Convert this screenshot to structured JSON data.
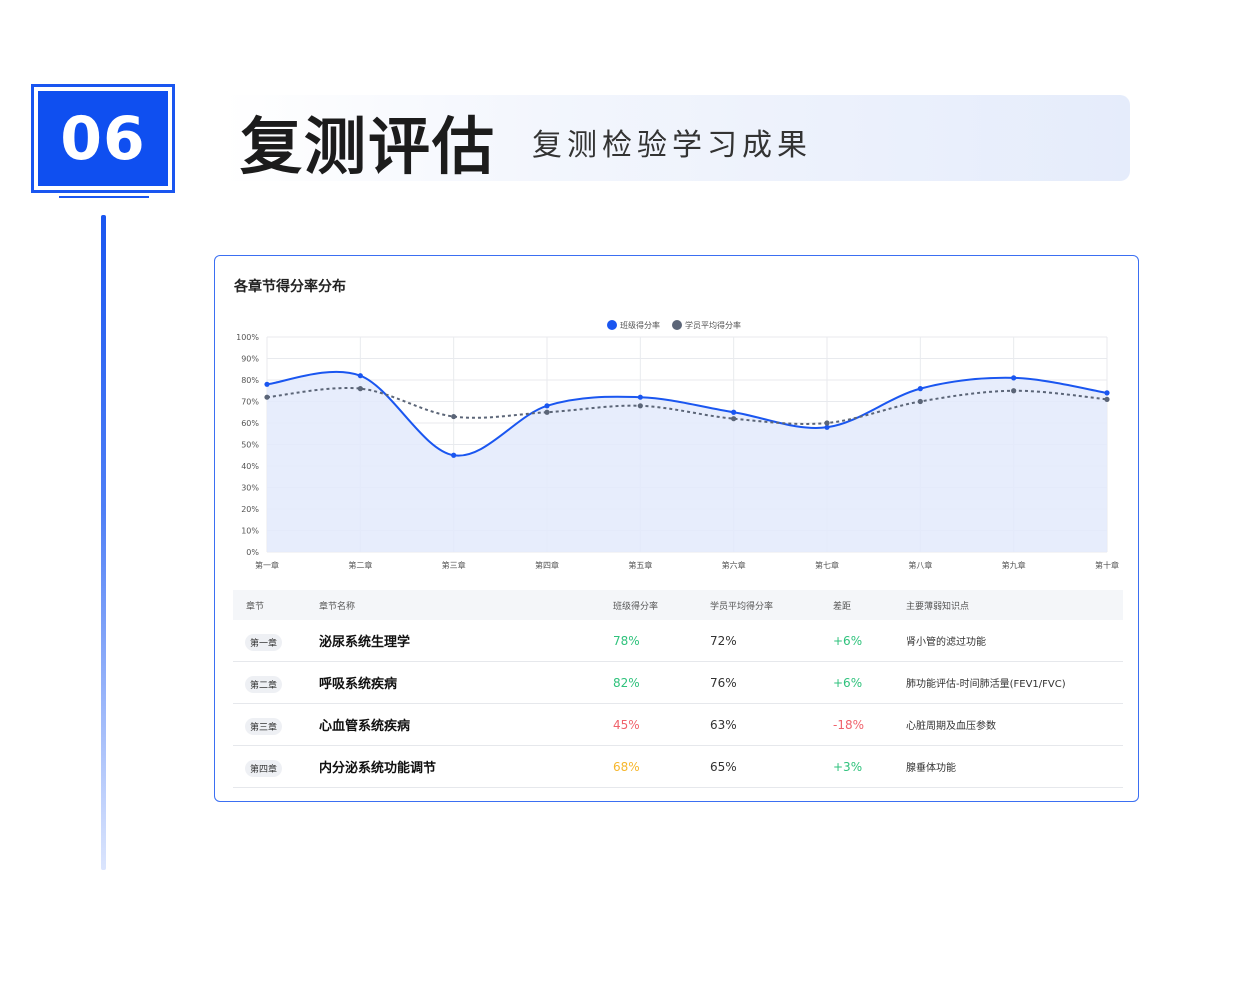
{
  "section": {
    "number": "06",
    "title": "复测评估",
    "subtitle": "复测检验学习成果"
  },
  "card": {
    "title": "各章节得分率分布"
  },
  "chart_data": {
    "type": "line",
    "categories": [
      "第一章",
      "第二章",
      "第三章",
      "第四章",
      "第五章",
      "第六章",
      "第七章",
      "第八章",
      "第九章",
      "第十章"
    ],
    "series": [
      {
        "name": "班级得分率",
        "values": [
          78,
          82,
          45,
          68,
          72,
          65,
          58,
          76,
          81,
          74
        ],
        "color": "#1a56f0",
        "style": "solid",
        "area": true
      },
      {
        "name": "学员平均得分率",
        "values": [
          72,
          76,
          63,
          65,
          68,
          62,
          60,
          70,
          75,
          71
        ],
        "color": "#5b6577",
        "style": "dashed",
        "area": false
      }
    ],
    "yticks": [
      "100%",
      "90%",
      "80%",
      "70%",
      "60%",
      "50%",
      "40%",
      "30%",
      "20%",
      "10%",
      "0%"
    ],
    "ylim": [
      0,
      100
    ],
    "grid": true,
    "legend_position": "top-center"
  },
  "table": {
    "headers": [
      "章节",
      "章节名称",
      "班级得分率",
      "学员平均得分率",
      "差距",
      "主要薄弱知识点"
    ],
    "rows": [
      {
        "chapter": "第一章",
        "name": "泌尿系统生理学",
        "class_rate": "78%",
        "avg_rate": "72%",
        "diff": "+6%",
        "weak": "肾小管的滤过功能",
        "rate_color": "green",
        "diff_color": "green"
      },
      {
        "chapter": "第二章",
        "name": "呼吸系统疾病",
        "class_rate": "82%",
        "avg_rate": "76%",
        "diff": "+6%",
        "weak": "肺功能评估-时间肺活量(FEV1/FVC)",
        "rate_color": "green",
        "diff_color": "green"
      },
      {
        "chapter": "第三章",
        "name": "心血管系统疾病",
        "class_rate": "45%",
        "avg_rate": "63%",
        "diff": "-18%",
        "weak": "心脏周期及血压参数",
        "rate_color": "red",
        "diff_color": "red"
      },
      {
        "chapter": "第四章",
        "name": "内分泌系统功能调节",
        "class_rate": "68%",
        "avg_rate": "65%",
        "diff": "+3%",
        "weak": "腺垂体功能",
        "rate_color": "orange",
        "diff_color": "green"
      }
    ]
  }
}
